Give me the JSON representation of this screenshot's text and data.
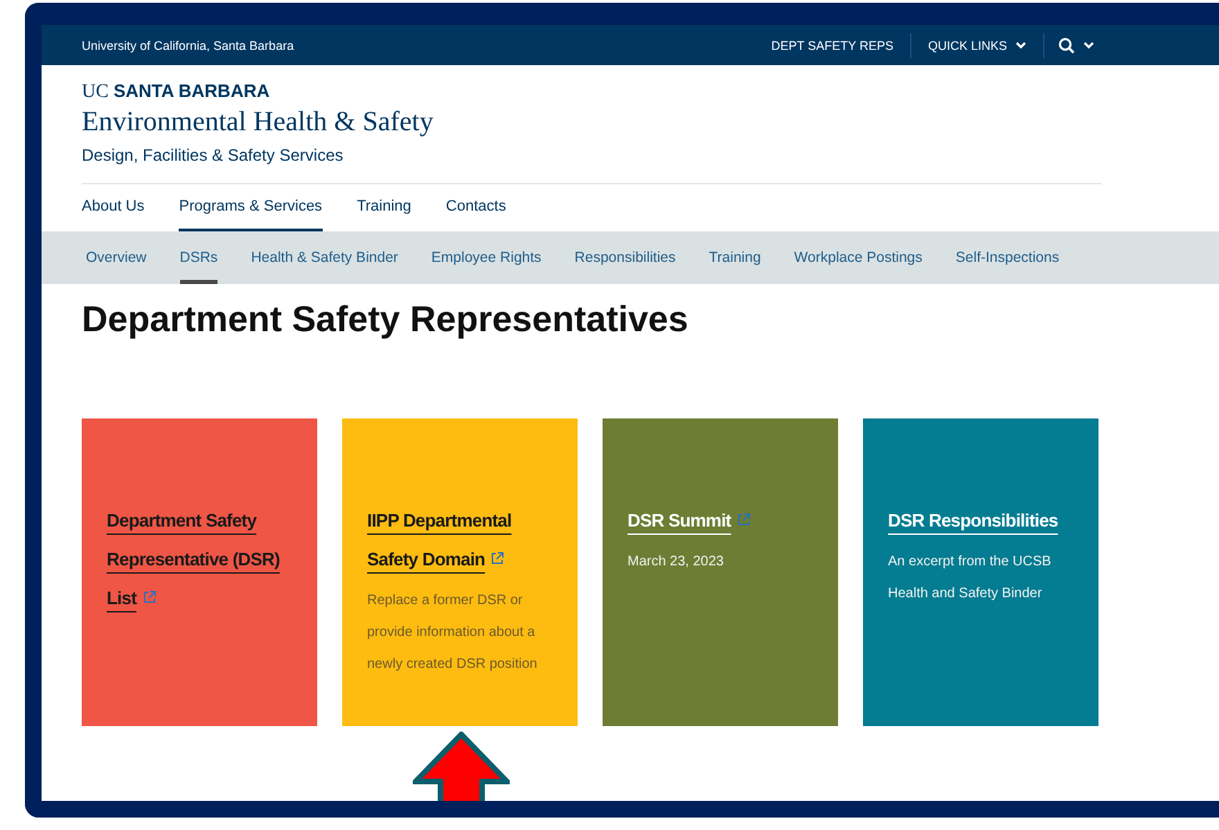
{
  "top_bar": {
    "university": "University of California, Santa Barbara",
    "links": [
      {
        "label": "DEPT SAFETY REPS",
        "dropdown": false
      },
      {
        "label": "QUICK LINKS",
        "dropdown": true
      }
    ]
  },
  "header": {
    "logo_prefix": "UC",
    "logo_name": "SANTA BARBARA",
    "site_title": "Environmental Health & Safety",
    "subtitle": "Design, Facilities & Safety Services"
  },
  "main_nav": [
    {
      "label": "About Us",
      "selected": false
    },
    {
      "label": "Programs & Services",
      "selected": true
    },
    {
      "label": "Training",
      "selected": false
    },
    {
      "label": "Contacts",
      "selected": false
    }
  ],
  "sub_nav": [
    {
      "label": "Overview",
      "selected": false
    },
    {
      "label": "DSRs",
      "selected": true
    },
    {
      "label": "Health & Safety Binder",
      "selected": false
    },
    {
      "label": "Employee Rights",
      "selected": false
    },
    {
      "label": "Responsibilities",
      "selected": false
    },
    {
      "label": "Training",
      "selected": false
    },
    {
      "label": "Workplace Postings",
      "selected": false
    },
    {
      "label": "Self-Inspections",
      "selected": false
    }
  ],
  "page_title": "Department Safety Representatives",
  "cards": [
    {
      "title": "Department Safety Representative (DSR) List",
      "external": true,
      "color": "#ef5645"
    },
    {
      "title": "IIPP Departmental Safety Domain",
      "external": true,
      "description": "Replace a former DSR or provide information about a newly created DSR position",
      "color": "#febc11"
    },
    {
      "title": "DSR Summit",
      "external": true,
      "description": "March 23, 2023",
      "color": "#6d7d33"
    },
    {
      "title": "DSR Responsibilities",
      "external": false,
      "description": "An excerpt from the UCSB Health and Safety Binder",
      "color": "#047c91"
    }
  ]
}
